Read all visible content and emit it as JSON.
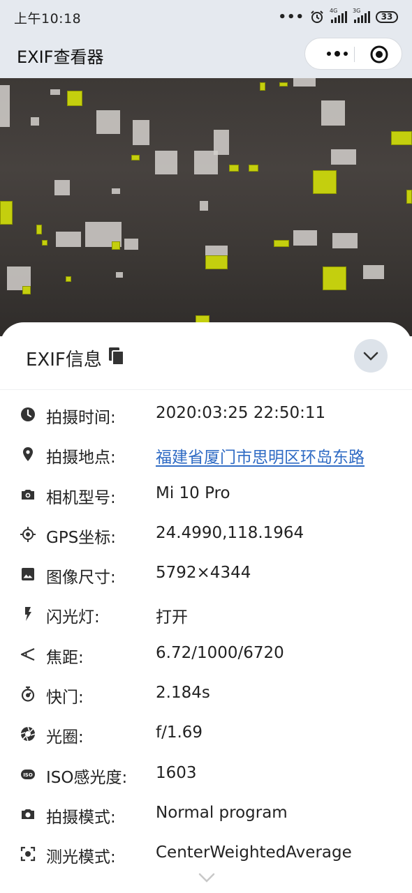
{
  "status_bar": {
    "time": "上午10:18",
    "signal1_label": "4G",
    "signal2_label": "3G",
    "battery": "33"
  },
  "navbar": {
    "title": "EXIF查看器"
  },
  "sheet": {
    "title": "EXIF信息",
    "rows": [
      {
        "icon": "clock-icon",
        "label": "拍摄时间:",
        "value": "2020:03:25 22:50:11"
      },
      {
        "icon": "location-pin-icon",
        "label": "拍摄地点:",
        "value": "福建省厦门市思明区环岛东路"
      },
      {
        "icon": "camera-icon",
        "label": "相机型号:",
        "value": "Mi 10 Pro"
      },
      {
        "icon": "gps-crosshair-icon",
        "label": "GPS坐标:",
        "value": "24.4990,118.1964"
      },
      {
        "icon": "image-icon",
        "label": "图像尺寸:",
        "value": "5792×4344"
      },
      {
        "icon": "flash-icon",
        "label": "闪光灯:",
        "value": "打开"
      },
      {
        "icon": "focal-length-icon",
        "label": "焦距:",
        "value": "6.72/1000/6720"
      },
      {
        "icon": "timer-icon",
        "label": "快门:",
        "value": "2.184s"
      },
      {
        "icon": "aperture-icon",
        "label": "光圈:",
        "value": "f/1.69"
      },
      {
        "icon": "iso-icon",
        "label": "ISO感光度:",
        "value": "1603"
      },
      {
        "icon": "camera-mode-icon",
        "label": "拍摄模式:",
        "value": "Normal program"
      },
      {
        "icon": "metering-icon",
        "label": "测光模式:",
        "value": "CenterWeightedAverage"
      }
    ]
  },
  "colors": {
    "link": "#2f6bc4",
    "bar_background": "#e5e9ef",
    "photo_highlight": "#c4cf0e"
  }
}
